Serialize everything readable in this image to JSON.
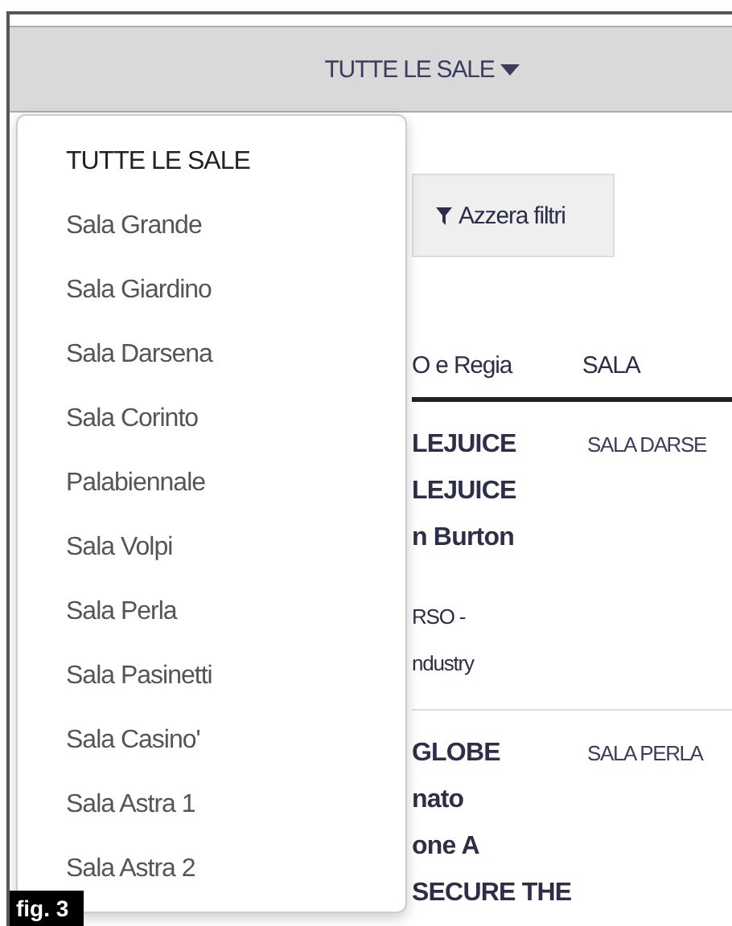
{
  "header": {
    "label": "TUTTE LE SALE"
  },
  "toolbar": {
    "reset_button": "Azzera filtri"
  },
  "table": {
    "columns": [
      "O e Regia",
      "SALA"
    ],
    "rows": [
      {
        "title_lines": [
          "LEJUICE",
          "LEJUICE",
          "n Burton"
        ],
        "section_lines": [
          "RSO -",
          "ndustry"
        ],
        "sala": "SALA DARSE"
      },
      {
        "title_lines": [
          "GLOBE",
          "nato",
          "one A",
          "SECURE THE"
        ],
        "section_lines": [],
        "sala": "SALA PERLA"
      }
    ]
  },
  "dropdown": {
    "items": [
      {
        "label": "TUTTE LE SALE",
        "selected": true
      },
      {
        "label": "Sala Grande",
        "selected": false
      },
      {
        "label": "Sala Giardino",
        "selected": false
      },
      {
        "label": "Sala Darsena",
        "selected": false
      },
      {
        "label": "Sala Corinto",
        "selected": false
      },
      {
        "label": "Palabiennale",
        "selected": false
      },
      {
        "label": "Sala Volpi",
        "selected": false
      },
      {
        "label": "Sala Perla",
        "selected": false
      },
      {
        "label": "Sala Pasinetti",
        "selected": false
      },
      {
        "label": "Sala Casino'",
        "selected": false
      },
      {
        "label": "Sala Astra 1",
        "selected": false
      },
      {
        "label": "Sala Astra 2",
        "selected": false
      }
    ]
  },
  "figure_label": "fig. 3"
}
